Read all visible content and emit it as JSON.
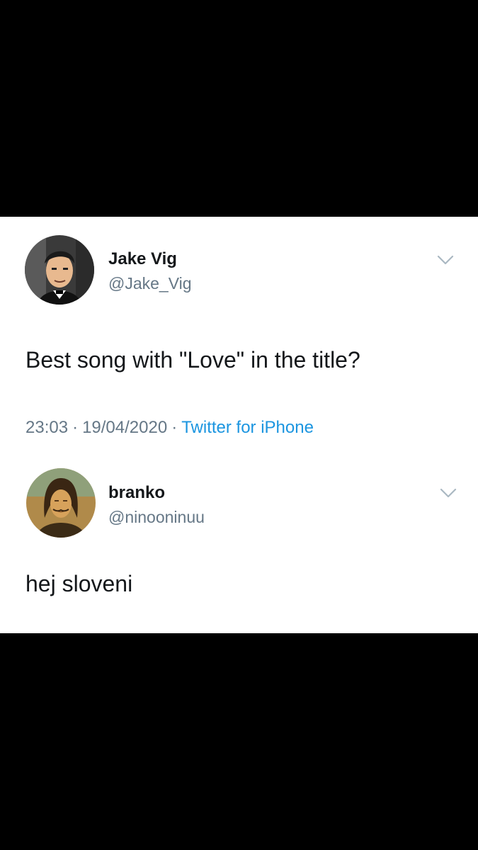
{
  "tweet": {
    "author_name": "Jake Vig",
    "author_handle": "@Jake_Vig",
    "text": "Best song with \"Love\" in the title?",
    "time": "23:03",
    "date": "19/04/2020",
    "source": "Twitter for iPhone",
    "separator": "·",
    "chevron_icon": "chevron-down-icon",
    "avatar_icon": "cartoon-avatar"
  },
  "reply": {
    "author_name": "branko",
    "author_handle": "@ninooninuu",
    "text": "hej sloveni",
    "chevron_icon": "chevron-down-icon",
    "avatar_icon": "mona-lisa-avatar"
  },
  "colors": {
    "background": "#000000",
    "card": "#ffffff",
    "text": "#14171a",
    "secondary": "#657786",
    "link": "#1b95e0"
  }
}
